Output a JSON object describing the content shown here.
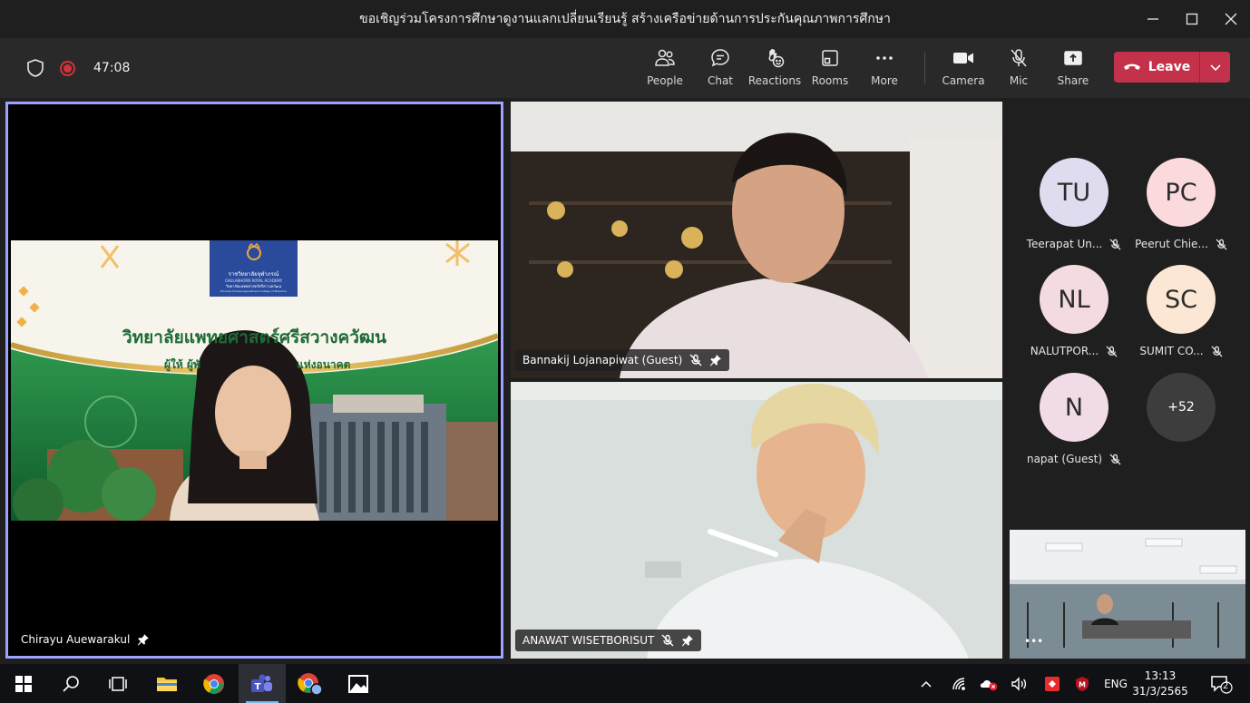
{
  "window": {
    "title": "ขอเชิญร่วมโครงการศึกษาดูงานแลกเปลี่ยนเรียนรู้ สร้างเครือข่ายด้านการประกันคุณภาพการศึกษา"
  },
  "toolbar": {
    "timer": "47:08",
    "buttons": {
      "people": "People",
      "chat": "Chat",
      "reactions": "Reactions",
      "rooms": "Rooms",
      "more": "More",
      "camera": "Camera",
      "mic": "Mic",
      "share": "Share"
    },
    "leave_label": "Leave"
  },
  "stage": {
    "presenter": {
      "name": "Chirayu Auewarakul",
      "slide": {
        "logo_line1": "ราชวิทยาลัยจุฬาภรณ์",
        "logo_line2": "CHULABHORN ROYAL ACADEMY",
        "logo_line3": "วิทยาลัยแพทยศาสตร์ศรีสวางควัฒน",
        "logo_line4": "Princess Srisavangavadhana College of Medicine",
        "heading": "วิทยาลัยแพทยศาสตร์ศรีสวางควัฒน",
        "subheading_left": "ผู้ให้ ผู้พั",
        "subheading_right": "แห่งอนาคต"
      }
    },
    "videos": [
      {
        "name": "Bannakij Lojanapiwat (Guest)"
      },
      {
        "name": "ANAWAT WISETBORISUT"
      }
    ],
    "avatars": [
      {
        "initials": "TU",
        "name": "Teerapat Un...",
        "color": "#dfdcf0"
      },
      {
        "initials": "PC",
        "name": "Peerut Chie...",
        "color": "#fadadd"
      },
      {
        "initials": "NL",
        "name": "NALUTPOR...",
        "color": "#f4dbe0"
      },
      {
        "initials": "SC",
        "name": "SUMIT CO...",
        "color": "#fbe7d3"
      },
      {
        "initials": "N",
        "name": "napat (Guest)",
        "color": "#f1dbe6"
      }
    ],
    "overflow_count": "+52",
    "self_view_more": "•••"
  },
  "taskbar": {
    "language": "ENG",
    "time": "13:13",
    "date": "31/3/2565",
    "notification_count": "2"
  }
}
